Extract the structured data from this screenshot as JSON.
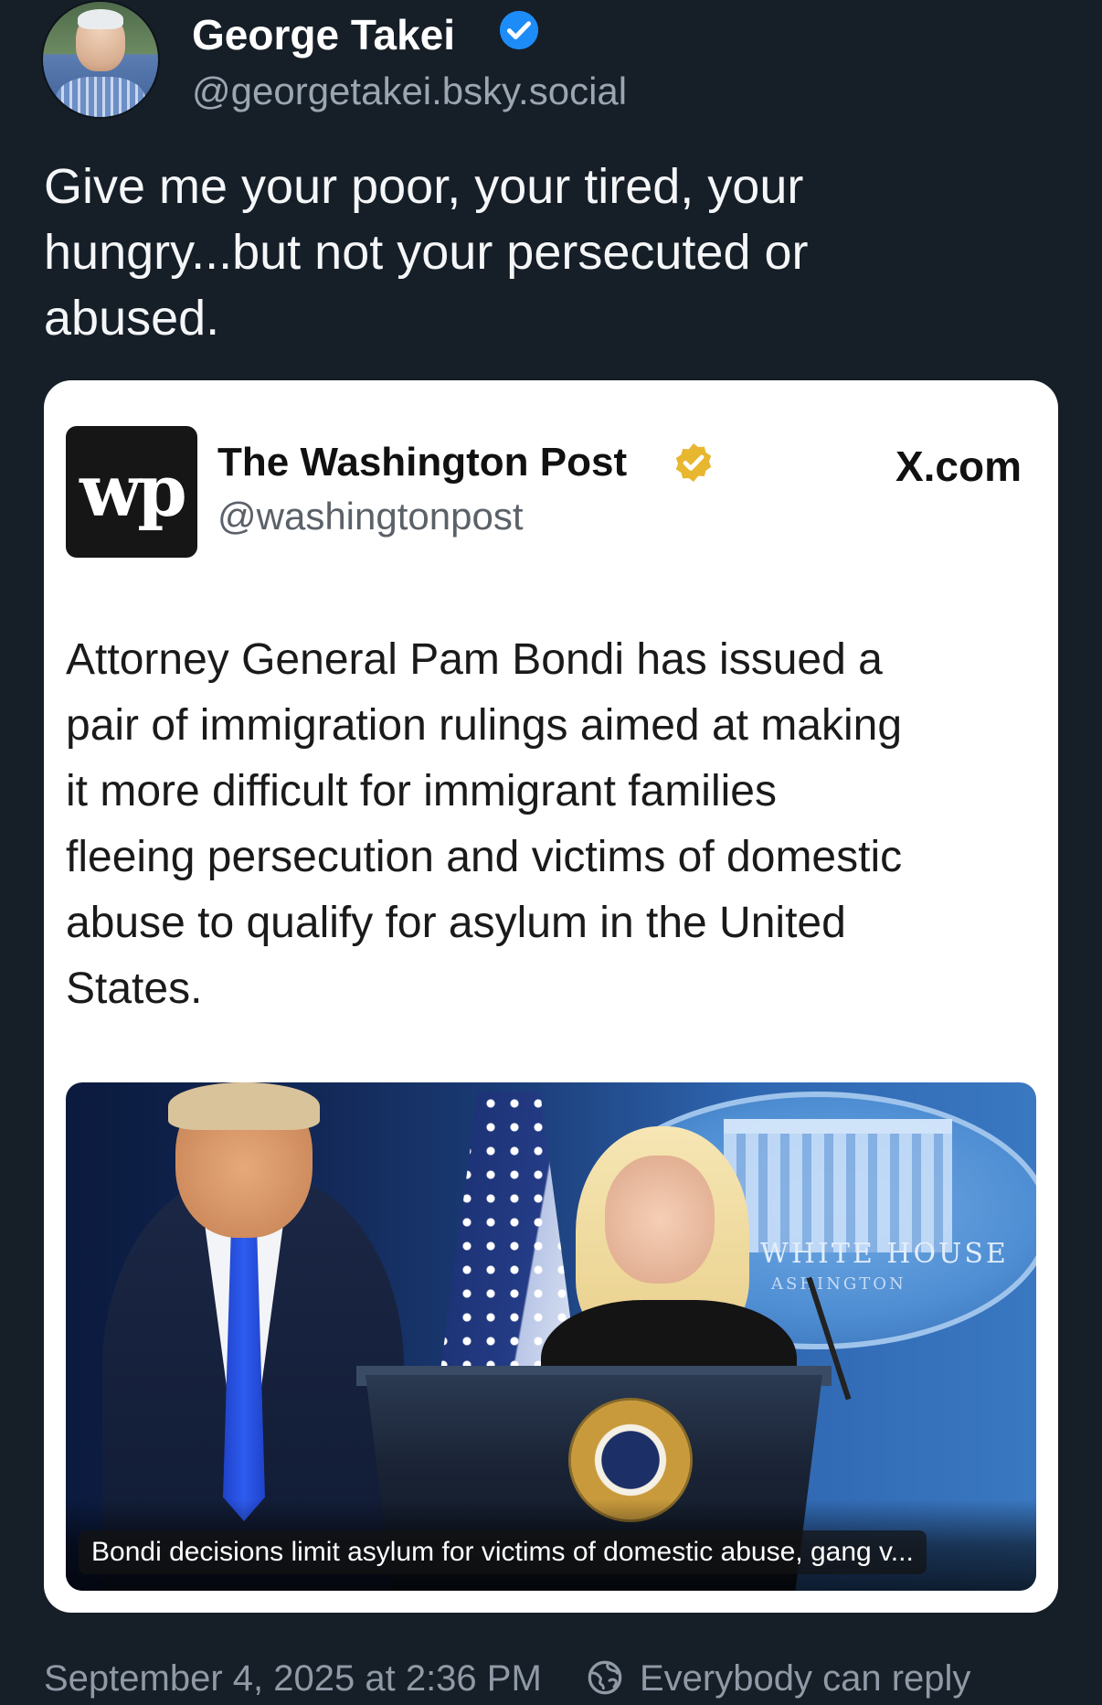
{
  "author": {
    "name": "George Takei",
    "handle": "@georgetakei.bsky.social",
    "verified_icon": "verified-check-icon",
    "verified_color": "#1d8cf8"
  },
  "post": {
    "text": "Give me your poor, your tired, your\nhungry...but not your persecuted or\nabused."
  },
  "embed": {
    "source_logo": "wp",
    "source_name": "The Washington Post",
    "source_verified_color": "#e8b730",
    "source_handle": "@washingtonpost",
    "platform": "X.com",
    "text": "Attorney General Pam Bondi has issued a\npair of immigration rulings aimed at making\nit more difficult for immigrant families\nfleeing persecution and victims of domestic\nabuse to qualify for asylum in the United\nStates.",
    "image_sign": "WHITE HOUSE",
    "image_sign_sub": "ASHINGTON",
    "image_caption": "Bondi decisions limit asylum for victims of domestic abuse, gang v..."
  },
  "footer": {
    "timestamp": "September 4, 2025 at 2:36 PM",
    "reply_setting": "Everybody can reply",
    "reply_icon": "globe-icon"
  },
  "colors": {
    "background": "#161e27",
    "muted_text": "#8f9aa6"
  }
}
